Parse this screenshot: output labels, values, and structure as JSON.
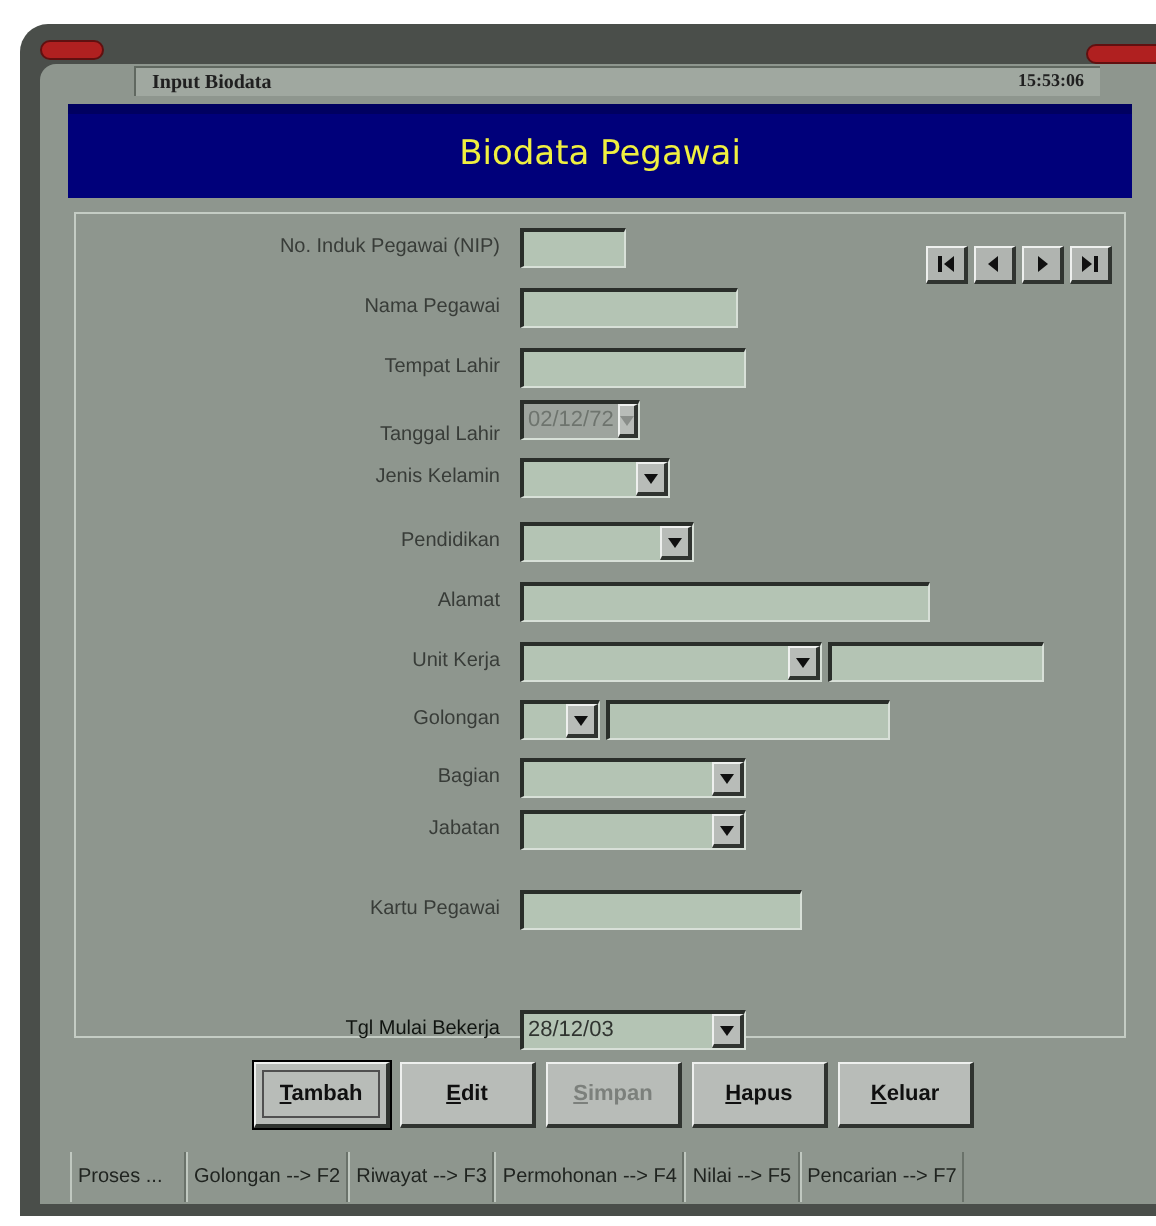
{
  "window": {
    "title": "Input Biodata",
    "clock": "15:53:06"
  },
  "banner": "Biodata Pegawai",
  "fields": [
    {
      "label": "No. Induk Pegawai (NIP)",
      "kind": "text",
      "disabled": false
    },
    {
      "label": "Nama Pegawai",
      "kind": "text",
      "disabled": false
    },
    {
      "label": "Tempat Lahir",
      "kind": "text",
      "disabled": false
    },
    {
      "label": "Tanggal Lahir",
      "kind": "dropdown",
      "value": "02/12/72",
      "disabled": true
    },
    {
      "label": "Jenis Kelamin",
      "kind": "dropdown",
      "disabled": false
    },
    {
      "label": "Pendidikan",
      "kind": "dropdown",
      "disabled": false
    },
    {
      "label": "Alamat",
      "kind": "text",
      "disabled": false
    },
    {
      "label": "Unit Kerja",
      "kind": "dropdown_text",
      "disabled": false
    },
    {
      "label": "Golongan",
      "kind": "dropdown_text",
      "disabled": false
    },
    {
      "label": "Bagian",
      "kind": "dropdown",
      "disabled": false
    },
    {
      "label": "Jabatan",
      "kind": "dropdown",
      "disabled": false
    },
    {
      "label": "Kartu Pegawai",
      "kind": "text",
      "disabled": false
    },
    {
      "label": "Tgl Mulai Bekerja",
      "kind": "dropdown",
      "value": "28/12/03",
      "disabled": false
    }
  ],
  "navigation": [
    {
      "kind": "first"
    },
    {
      "kind": "previous"
    },
    {
      "kind": "next"
    },
    {
      "kind": "last"
    }
  ],
  "buttons": [
    {
      "hotkey": "T",
      "rest": "ambah",
      "selected": true,
      "disabled": false
    },
    {
      "hotkey": "E",
      "rest": "dit",
      "selected": false,
      "disabled": false
    },
    {
      "hotkey": "S",
      "rest": "impan",
      "selected": false,
      "disabled": true
    },
    {
      "hotkey": "H",
      "rest": "apus",
      "selected": false,
      "disabled": false
    },
    {
      "hotkey": "K",
      "rest": "eluar",
      "selected": false,
      "disabled": false
    }
  ],
  "status_bar": [
    "Proses ...",
    "Golongan --> F2",
    "Riwayat --> F3",
    "Permohonan --> F4",
    "Nilai --> F5",
    "Pencarian --> F7"
  ]
}
